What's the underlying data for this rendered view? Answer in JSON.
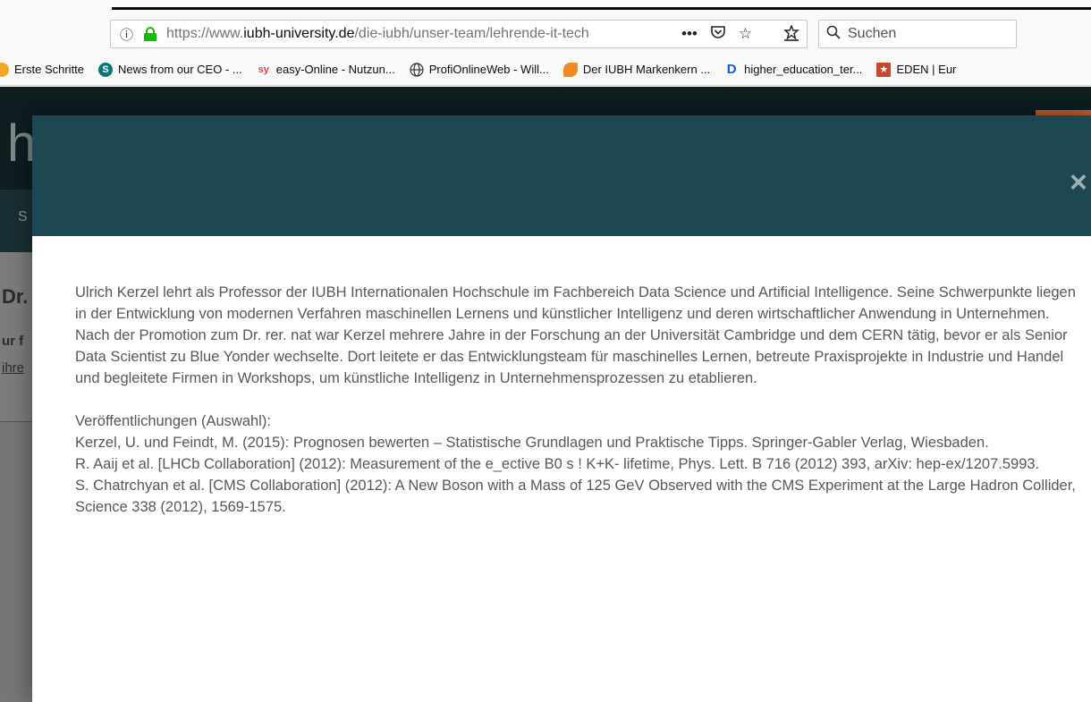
{
  "browser": {
    "url_prefix": "https://www.",
    "url_domain": "iubh-university.de",
    "url_path": "/die-iubh/unser-team/lehrende-it-tech",
    "page_actions_icon": "•••",
    "pocket_icon": "pocket-icon",
    "bookmark_star_icon": "star-icon",
    "library_icon": "library-icon",
    "search_placeholder": "Suchen",
    "bookmarks": [
      {
        "label": "Erste Schritte",
        "icon": "firefox-icon",
        "color": "#f5a623"
      },
      {
        "label": "News from our CEO - ...",
        "icon": "sharepoint-icon",
        "color": "#03787c"
      },
      {
        "label": "easy-Online - Nutzun...",
        "icon": "easy-icon",
        "color": "#e8423f"
      },
      {
        "label": "ProfiOnlineWeb - Will...",
        "icon": "globe-icon",
        "color": "#333333"
      },
      {
        "label": "Der IUBH Markenkern ...",
        "icon": "iubh-icon",
        "color": "#f08a24"
      },
      {
        "label": "higher_education_ter...",
        "icon": "d-icon",
        "color": "#0f5bd6"
      },
      {
        "label": "EDEN | Eur",
        "icon": "eden-icon",
        "color": "#c9482b"
      }
    ]
  },
  "page": {
    "logo_fragment": "h",
    "nav_fragment": "S",
    "heading_fragment": "Dr.",
    "sub_fragment": "ur f",
    "link_fragment": "ihre"
  },
  "modal": {
    "close_label": "×",
    "paragraph1": "Ulrich Kerzel lehrt als Professor der IUBH Internationalen Hochschule im Fachbereich Data Science und Artificial Intelligence. Seine Schwerpunkte liegen in der Entwicklung von modernen Verfahren maschinellen Lernens und künstlicher Intelligenz und deren wirtschaftlicher Anwendung in Unternehmen.",
    "paragraph2": "Nach der Promotion zum Dr. rer. nat war Kerzel mehrere Jahre in der Forschung an der Universität Cambridge und dem CERN tätig, bevor er als Senior Data Scientist zu Blue Yonder wechselte. Dort leitete er das Entwicklungsteam für maschinelles Lernen, betreute Praxisprojekte in Industrie und Handel und begleitete Firmen in Workshops, um künstliche Intelligenz in Unternehmensprozessen zu etablieren.",
    "publications_heading": "Veröffentlichungen (Auswahl):",
    "publications": [
      "Kerzel, U. und Feindt, M. (2015): Prognosen bewerten – Statistische Grundlagen und Praktische Tipps. Springer-Gabler Verlag, Wiesbaden.",
      "R. Aaij et al. [LHCb Collaboration] (2012): Measurement of the e_ective B0 s ! K+K- lifetime, Phys. Lett. B 716 (2012) 393, arXiv: hep-ex/1207.5993.",
      "S. Chatrchyan et al. [CMS Collaboration] (2012): A New Boson with a Mass of 125 GeV Observed with the CMS Experiment at the Large Hadron Collider, Science 338 (2012), 1569-1575."
    ]
  }
}
